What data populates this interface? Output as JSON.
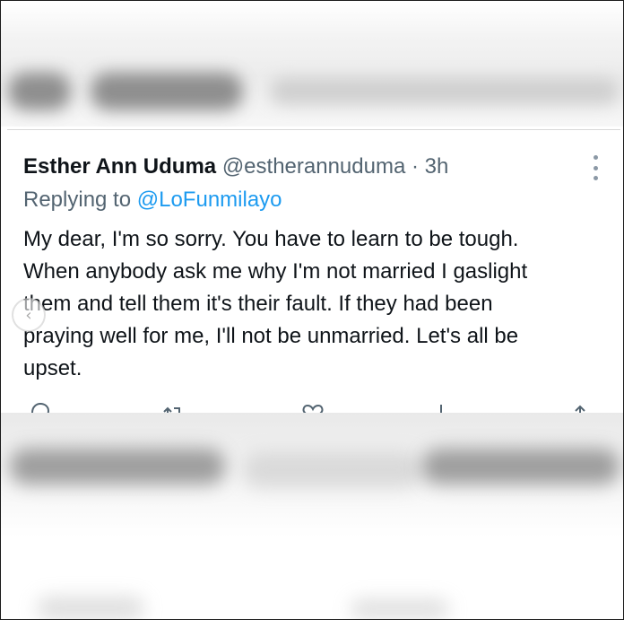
{
  "tweet": {
    "author_name": "Esther Ann Uduma",
    "author_handle": "@estherannuduma",
    "separator": "·",
    "timestamp": "3h",
    "reply_prefix": "Replying to",
    "reply_handle": "@LoFunmilayo",
    "body_lines": [
      "My dear, I'm so sorry. You have to learn to be tough.",
      "When anybody ask me why I'm not married I gaslight",
      "them and tell them it's their fault. If they had been",
      "praying well for me, I'll not be unmarried. Let's all be",
      "upset."
    ],
    "actions": [
      {
        "name": "reply",
        "icon": "reply-icon"
      },
      {
        "name": "retweet",
        "icon": "retweet-icon"
      },
      {
        "name": "like",
        "icon": "heart-icon"
      },
      {
        "name": "views",
        "icon": "views-icon"
      },
      {
        "name": "share",
        "icon": "share-icon"
      }
    ]
  },
  "colors": {
    "text": "#0f1419",
    "muted": "#536471",
    "link": "#1d9bf0"
  }
}
